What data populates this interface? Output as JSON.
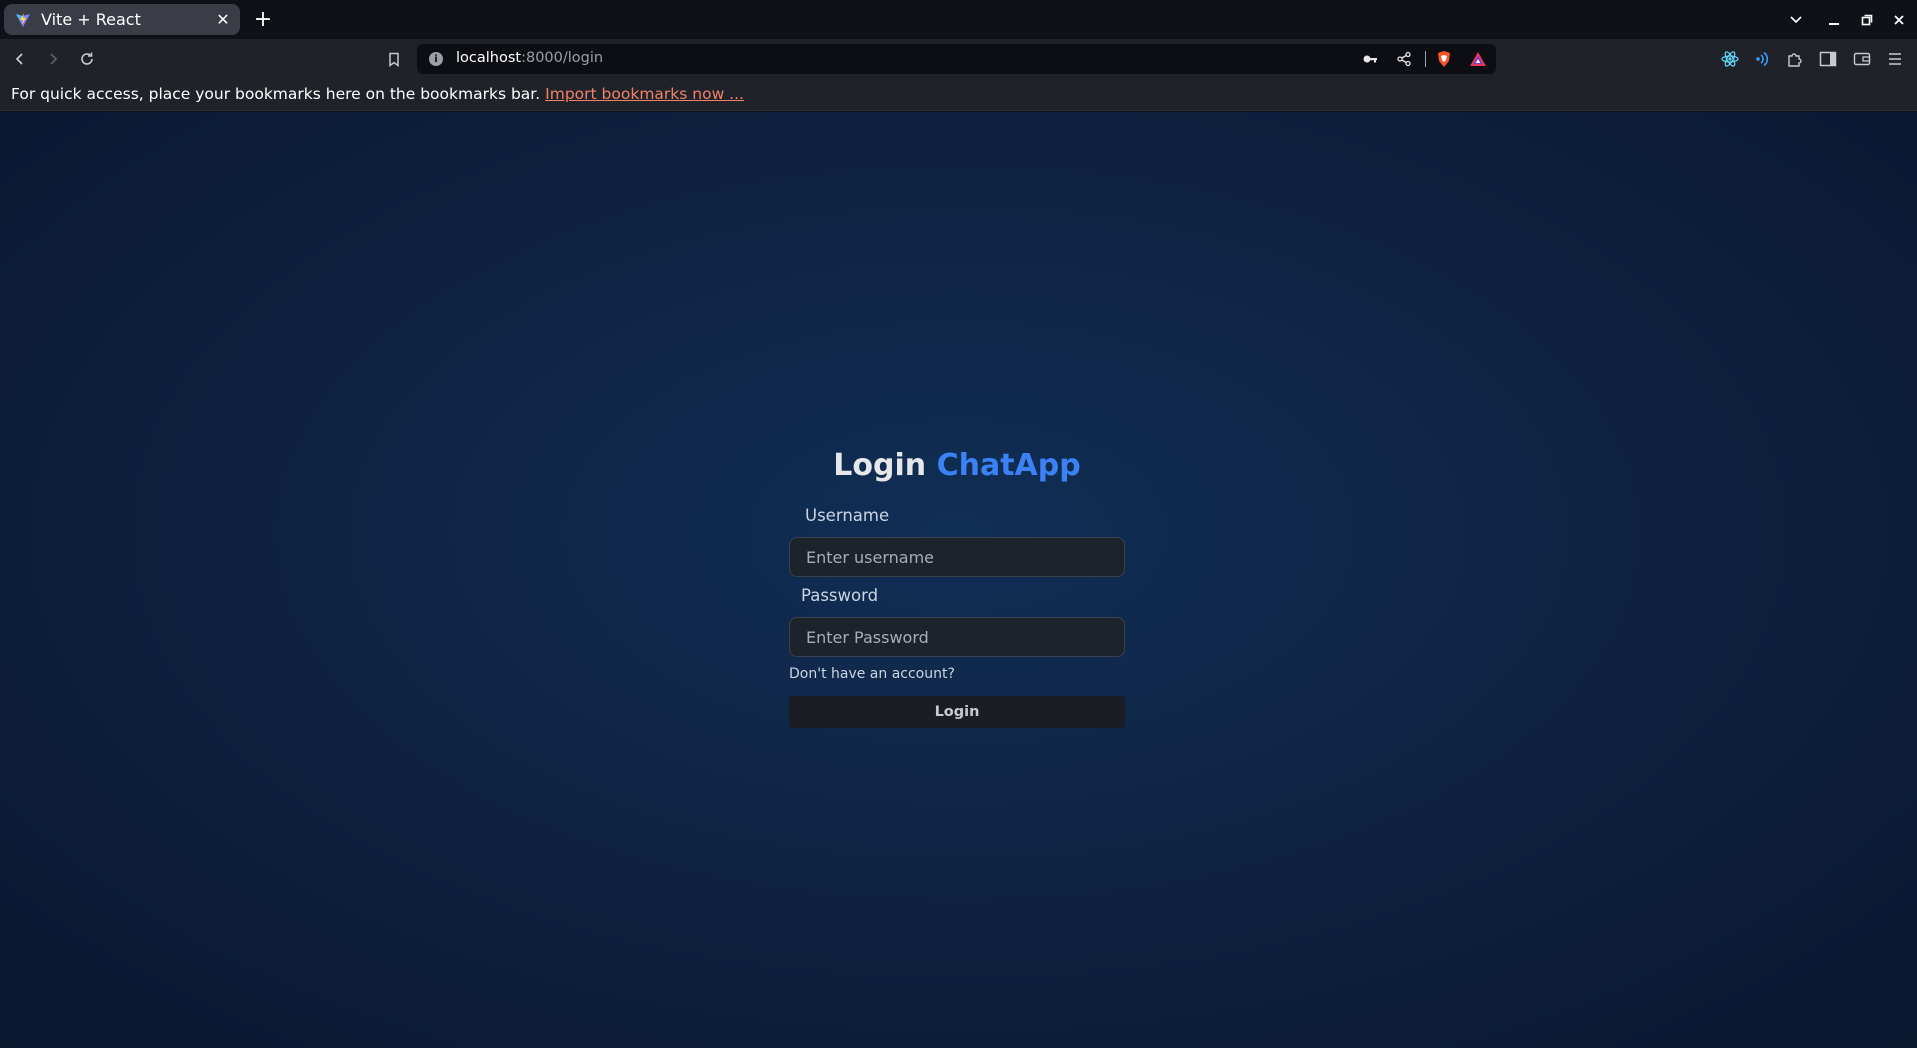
{
  "browser": {
    "tab_title": "Vite + React",
    "tab_close": "✕",
    "new_tab": "+",
    "url_host": "localhost",
    "url_rest": ":8000/login",
    "url_info": "i",
    "bookmarks_message": "For quick access, place your bookmarks here on the bookmarks bar.",
    "bookmarks_import_link": "Import bookmarks now ..."
  },
  "login": {
    "title_prefix": "Login",
    "title_brand": "ChatApp",
    "username_label": "Username",
    "username_placeholder": "Enter username",
    "password_label": "Password",
    "password_placeholder": "Enter Password",
    "signup_link": "Don't have an account?",
    "submit_label": "Login"
  },
  "colors": {
    "brand_accent": "#3b82f6",
    "bookmark_link": "#f0826b",
    "page_background": "#0f2647"
  }
}
